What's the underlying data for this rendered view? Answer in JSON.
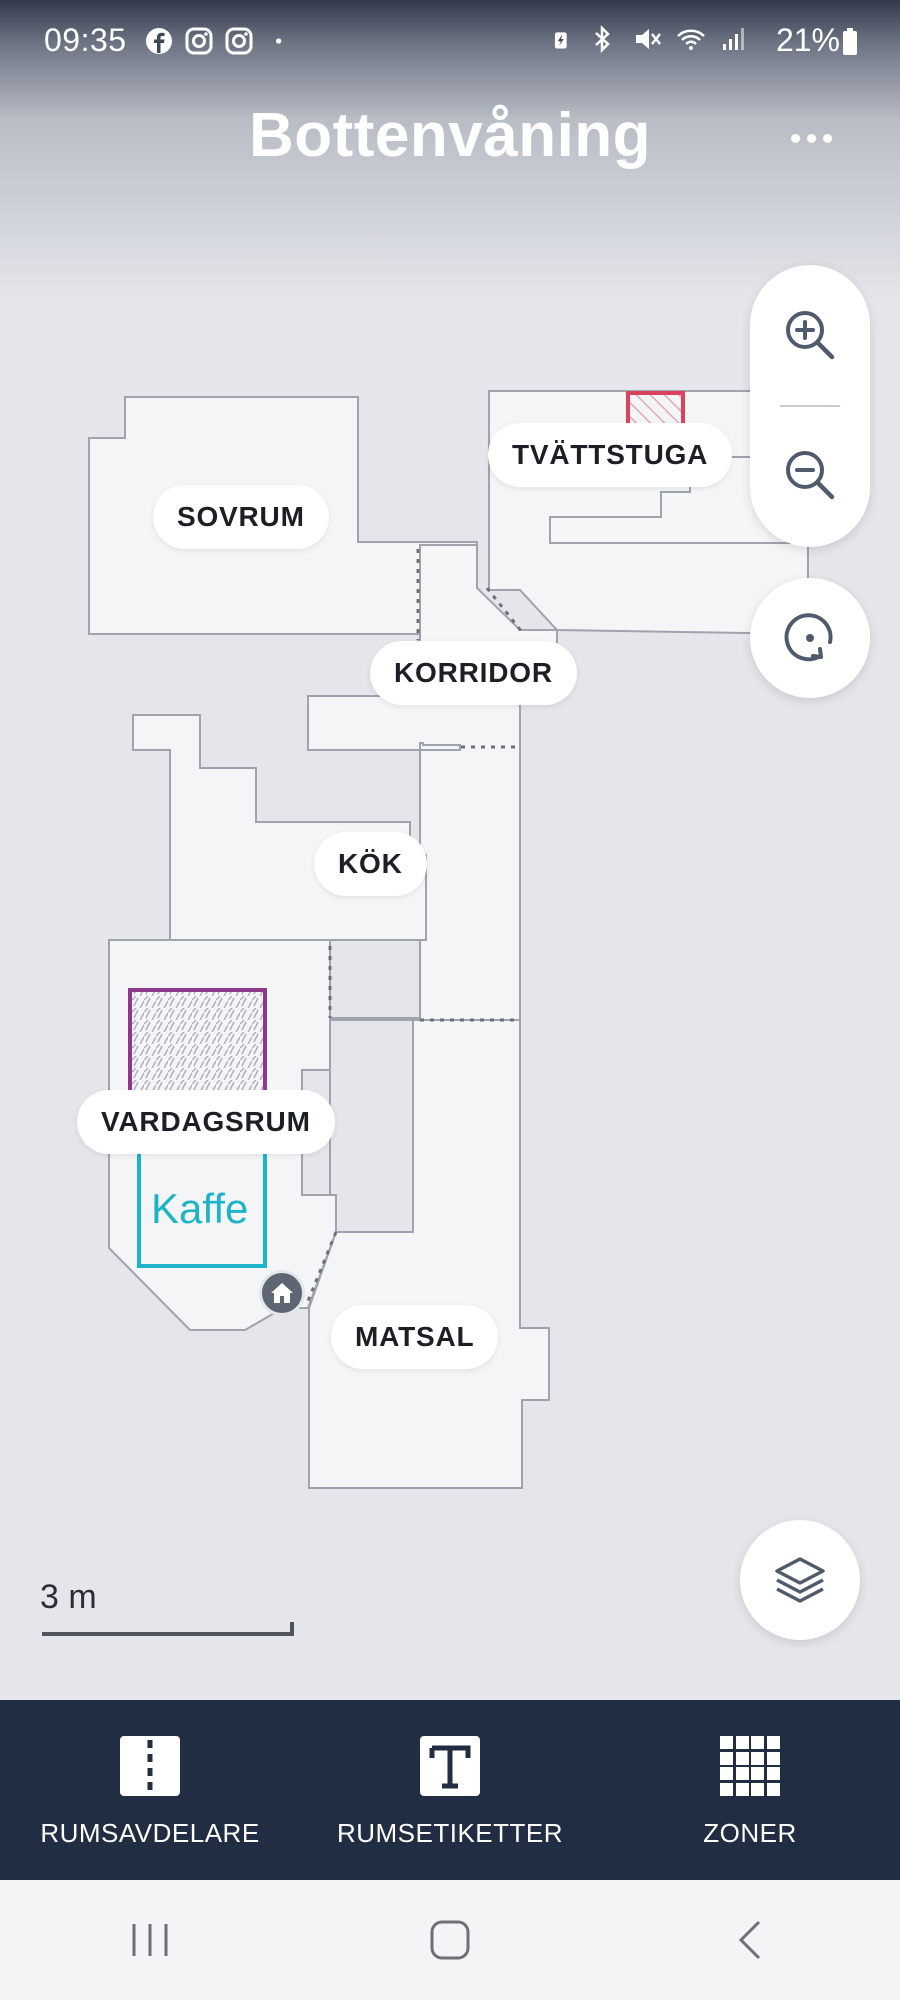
{
  "status_bar": {
    "time": "09:35",
    "notification_icons": [
      "facebook-icon",
      "instagram-icon",
      "instagram-icon",
      "dot-icon"
    ],
    "system_icons": [
      "battery-saver-icon",
      "bluetooth-icon",
      "mute-icon",
      "wifi-icon",
      "signal-icon"
    ],
    "battery_percent": "21%"
  },
  "header": {
    "title": "Bottenvåning",
    "more_icon": "more-horizontal-icon"
  },
  "map": {
    "rooms": [
      {
        "name": "SOVRUM"
      },
      {
        "name": "TVÄTTSTUGA"
      },
      {
        "name": "KORRIDOR"
      },
      {
        "name": "KÖK"
      },
      {
        "name": "VARDAGSRUM"
      },
      {
        "name": "MATSAL"
      }
    ],
    "zones": [
      {
        "name": "Kaffe",
        "color": "#1fb3c8"
      }
    ],
    "no_go_zone_color": "#d9435e",
    "no_mop_zone_color": "#8e3a8c",
    "dock_icon": "home-icon"
  },
  "controls": {
    "zoom_in_icon": "zoom-in-icon",
    "zoom_out_icon": "zoom-out-icon",
    "rotate_icon": "rotate-icon",
    "layers_icon": "layers-icon"
  },
  "scale": {
    "label": "3 m"
  },
  "toolbar": {
    "items": [
      {
        "label": "RUMSAVDELARE",
        "icon": "room-divider-icon"
      },
      {
        "label": "RUMSETIKETTER",
        "icon": "room-label-icon"
      },
      {
        "label": "ZONER",
        "icon": "zones-grid-icon"
      }
    ]
  },
  "navbar": {
    "recent_icon": "recent-apps-icon",
    "home_icon": "home-button-icon",
    "back_icon": "back-icon"
  }
}
